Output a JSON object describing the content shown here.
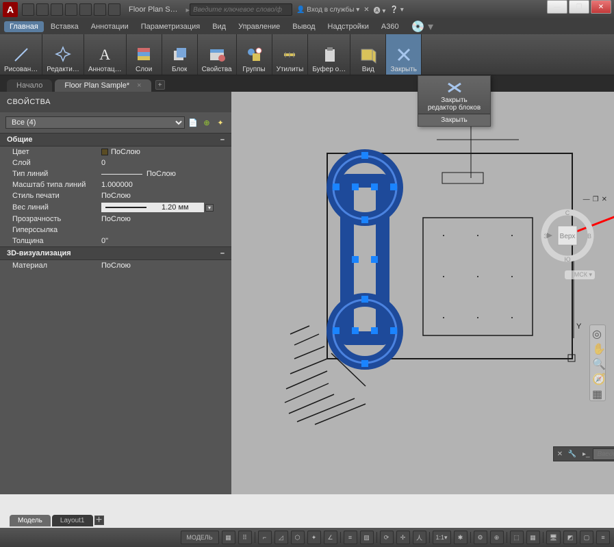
{
  "window": {
    "title": "Floor Plan S…",
    "search_placeholder": "Введите ключевое слово/фразу",
    "signin": "Вход в службы",
    "min": "—",
    "max": "❐",
    "close": "✕"
  },
  "menus": [
    "Главная",
    "Вставка",
    "Аннотации",
    "Параметризация",
    "Вид",
    "Управление",
    "Вывод",
    "Надстройки",
    "A360"
  ],
  "ribbon_panels": [
    {
      "label": "Рисован…",
      "icon": "/",
      "name": "draw"
    },
    {
      "label": "Редакти…",
      "icon": "✥",
      "name": "modify"
    },
    {
      "label": "Аннотац…",
      "icon": "A",
      "name": "annotate"
    },
    {
      "label": "Слои",
      "icon": "layers",
      "name": "layers"
    },
    {
      "label": "Блок",
      "icon": "block",
      "name": "block"
    },
    {
      "label": "Свойства",
      "icon": "props",
      "name": "properties"
    },
    {
      "label": "Группы",
      "icon": "groups",
      "name": "groups"
    },
    {
      "label": "Утилиты",
      "icon": "util",
      "name": "utilities"
    },
    {
      "label": "Буфер о…",
      "icon": "clip",
      "name": "clipboard"
    },
    {
      "label": "Вид",
      "icon": "view",
      "name": "view"
    },
    {
      "label": "Закрыть",
      "icon": "x",
      "name": "close",
      "active": true
    }
  ],
  "doc_tabs": [
    {
      "label": "Начало",
      "active": false
    },
    {
      "label": "Floor Plan Sample*",
      "active": true
    }
  ],
  "close_panel": {
    "line1": "Закрыть",
    "line2": "редактор блоков",
    "button": "Закрыть"
  },
  "palette": {
    "title": "СВОЙСТВА",
    "selection": "Все (4)",
    "cat1": "Общие",
    "rows": [
      {
        "label": "Цвет",
        "value": "ПоСлою",
        "swatch": "#5a4c24"
      },
      {
        "label": "Слой",
        "value": "0"
      },
      {
        "label": "Тип линий",
        "value": "ПоСлою",
        "line": true
      },
      {
        "label": "Масштаб типа линий",
        "value": "1.000000"
      },
      {
        "label": "Стиль печати",
        "value": "ПоСлою"
      },
      {
        "label": "Вес линий",
        "value": "1.20 мм",
        "highlight": true
      },
      {
        "label": "Прозрачность",
        "value": "ПоСлою"
      },
      {
        "label": "Гиперссылка",
        "value": ""
      },
      {
        "label": "Толщина",
        "value": "0\""
      }
    ],
    "cat2": "3D-визуализация",
    "rows2": [
      {
        "label": "Материал",
        "value": "ПоСлою"
      }
    ]
  },
  "viewcube": {
    "face": "Верх",
    "coord": "МСК",
    "n": "С",
    "s": "Ю",
    "e": "В",
    "w": "З"
  },
  "cmd_placeholder": "Введите команду",
  "layout_tabs": [
    {
      "label": "Модель",
      "active": true
    },
    {
      "label": "Layout1",
      "active": false
    }
  ],
  "statusbar": {
    "model": "МОДЕЛЬ",
    "scale": "1:1"
  }
}
